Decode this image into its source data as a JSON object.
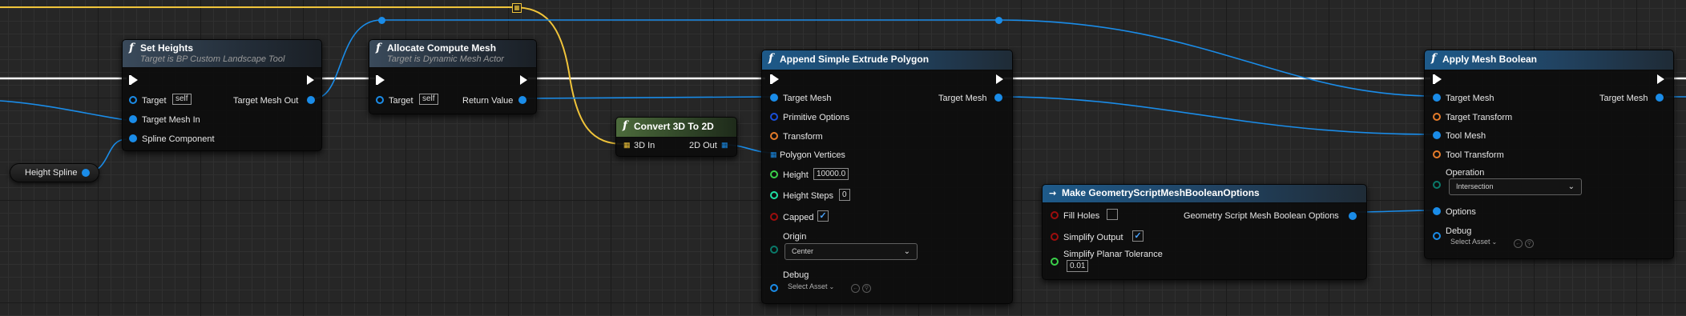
{
  "colors": {
    "exec": "#ffffff",
    "object_pin": "#1a8ce8",
    "vector_pin": "#f0c43a",
    "transform_pin": "#e47b2a",
    "bool_pin": "#9d0d0d",
    "float_pin": "#3bd14a",
    "int_pin": "#1fdfa4",
    "enum_pin": "#0a7a6a"
  },
  "set_heights": {
    "icon": "function-f-icon",
    "title": "Set Heights",
    "subtitle": "Target is BP Custom Landscape Tool",
    "target_label": "Target",
    "target_value": "self",
    "target_mesh_out": "Target Mesh Out",
    "target_mesh_in": "Target Mesh In",
    "spline_component": "Spline Component"
  },
  "height_spline": {
    "label": "Height Spline"
  },
  "allocate": {
    "title": "Allocate Compute Mesh",
    "subtitle": "Target is Dynamic Mesh Actor",
    "target_label": "Target",
    "target_value": "self",
    "return_value": "Return Value"
  },
  "convert": {
    "title": "Convert 3D To 2D",
    "in_label": "3D In",
    "out_label": "2D Out"
  },
  "extrude": {
    "title": "Append Simple Extrude Polygon",
    "target_mesh": "Target Mesh",
    "target_mesh_out": "Target Mesh",
    "primitive_options": "Primitive Options",
    "transform": "Transform",
    "polygon_vertices": "Polygon Vertices",
    "height_label": "Height",
    "height_value": "10000.0",
    "height_steps_label": "Height Steps",
    "height_steps_value": "0",
    "capped_label": "Capped",
    "capped_checked": true,
    "origin_label": "Origin",
    "origin_value": "Center",
    "debug_label": "Debug",
    "debug_value": "Select Asset"
  },
  "bool_options": {
    "title": "Make GeometryScriptMeshBooleanOptions",
    "fill_holes_label": "Fill Holes",
    "fill_holes_checked": false,
    "simplify_output_label": "Simplify Output",
    "simplify_output_checked": true,
    "tolerance_label": "Simplify Planar Tolerance",
    "tolerance_value": "0.01",
    "output_label": "Geometry Script Mesh Boolean Options"
  },
  "apply_boolean": {
    "title": "Apply Mesh Boolean",
    "target_mesh": "Target Mesh",
    "target_mesh_out": "Target Mesh",
    "target_transform": "Target Transform",
    "tool_mesh": "Tool Mesh",
    "tool_transform": "Tool Transform",
    "operation_label": "Operation",
    "operation_value": "Intersection",
    "options_label": "Options",
    "debug_label": "Debug",
    "debug_value": "Select Asset"
  }
}
